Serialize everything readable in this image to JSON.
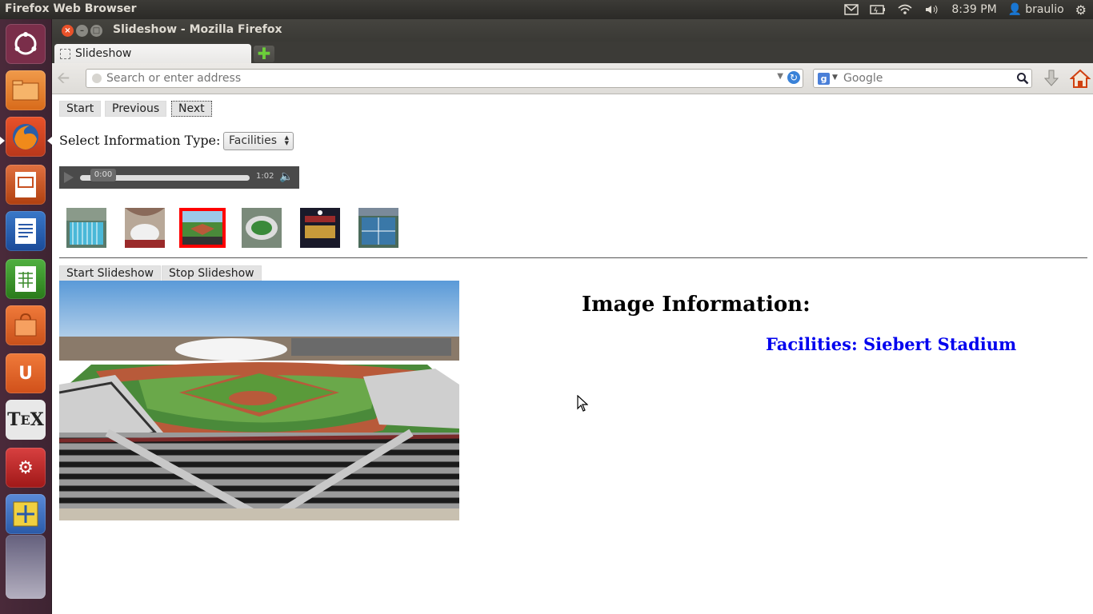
{
  "panel": {
    "app_title": "Firefox Web Browser",
    "clock": "8:39 PM",
    "user": "braulio"
  },
  "window": {
    "title": "Slideshow - Mozilla Firefox"
  },
  "tabs": [
    {
      "label": "Slideshow"
    }
  ],
  "navbar": {
    "url_placeholder": "Search or enter address",
    "search_placeholder": "Google"
  },
  "page": {
    "nav_buttons": {
      "start": "Start",
      "previous": "Previous",
      "next": "Next"
    },
    "select_label": "Select Information Type:",
    "select_value": "Facilities",
    "audio": {
      "current_time": "0:00",
      "duration": "1:02",
      "progress": 0
    },
    "thumbnails_selected_index": 2,
    "slideshow_buttons": {
      "start": "Start Slideshow",
      "stop": "Stop Slideshow"
    },
    "info_heading": "Image Information:",
    "info_caption": "Facilities: Siebert Stadium"
  },
  "colors": {
    "caption": "#0000ee",
    "thumbnail_highlight": "#ff0000"
  }
}
